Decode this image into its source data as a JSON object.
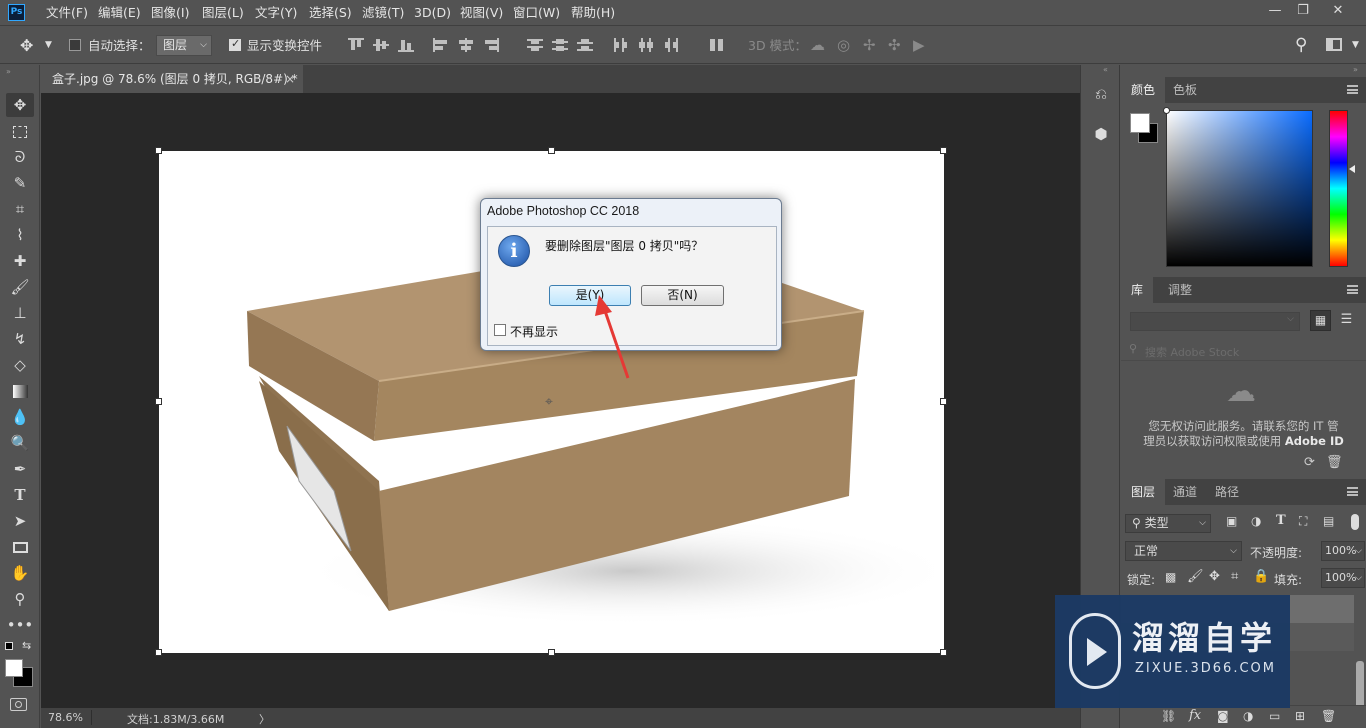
{
  "menubar": {
    "logo": "Ps",
    "items": [
      "文件(F)",
      "编辑(E)",
      "图像(I)",
      "图层(L)",
      "文字(Y)",
      "选择(S)",
      "滤镜(T)",
      "3D(D)",
      "视图(V)",
      "窗口(W)",
      "帮助(H)"
    ],
    "window_controls": [
      "—",
      "❐",
      "✕"
    ]
  },
  "options": {
    "auto_select_label": "自动选择：",
    "auto_select_value": "图层",
    "show_transform_label": "显示变换控件",
    "mode3d_label": "3D 模式："
  },
  "document": {
    "tab_title": "盒子.jpg @ 78.6% (图层 0 拷贝, RGB/8#) *",
    "tab_close": "×"
  },
  "status": {
    "zoom": "78.6%",
    "doc_size": "文档:1.83M/3.66M",
    "arrow": "〉"
  },
  "dialog": {
    "title": "Adobe Photoshop CC 2018",
    "message": "要删除图层\"图层 0 拷贝\"吗？",
    "yes_label": "是(Y)",
    "no_label": "否(N)",
    "dont_show_label": "不再显示"
  },
  "color_panel": {
    "tabs": [
      "颜色",
      "色板"
    ],
    "foreground": "#ffffff",
    "background": "#000000"
  },
  "library_panel": {
    "tabs": [
      "库",
      "调整"
    ],
    "search_placeholder": "搜索 Adobe Stock",
    "message_line1": "您无权访问此服务。请联系您的 IT 管",
    "message_line2": "理员以获取访问权限或使用",
    "message_bold": "Adobe ID"
  },
  "layers_panel": {
    "tabs": [
      "图层",
      "通道",
      "路径"
    ],
    "filter_label": "类型",
    "blend_mode": "正常",
    "opacity_label": "不透明度:",
    "opacity_value": "100%",
    "lock_label": "锁定:",
    "fill_label": "填充:",
    "fill_value": "100%",
    "footer_fx": "fx"
  },
  "watermark": {
    "brand": "溜溜自学",
    "url": "ZIXUE.3D66.COM"
  }
}
